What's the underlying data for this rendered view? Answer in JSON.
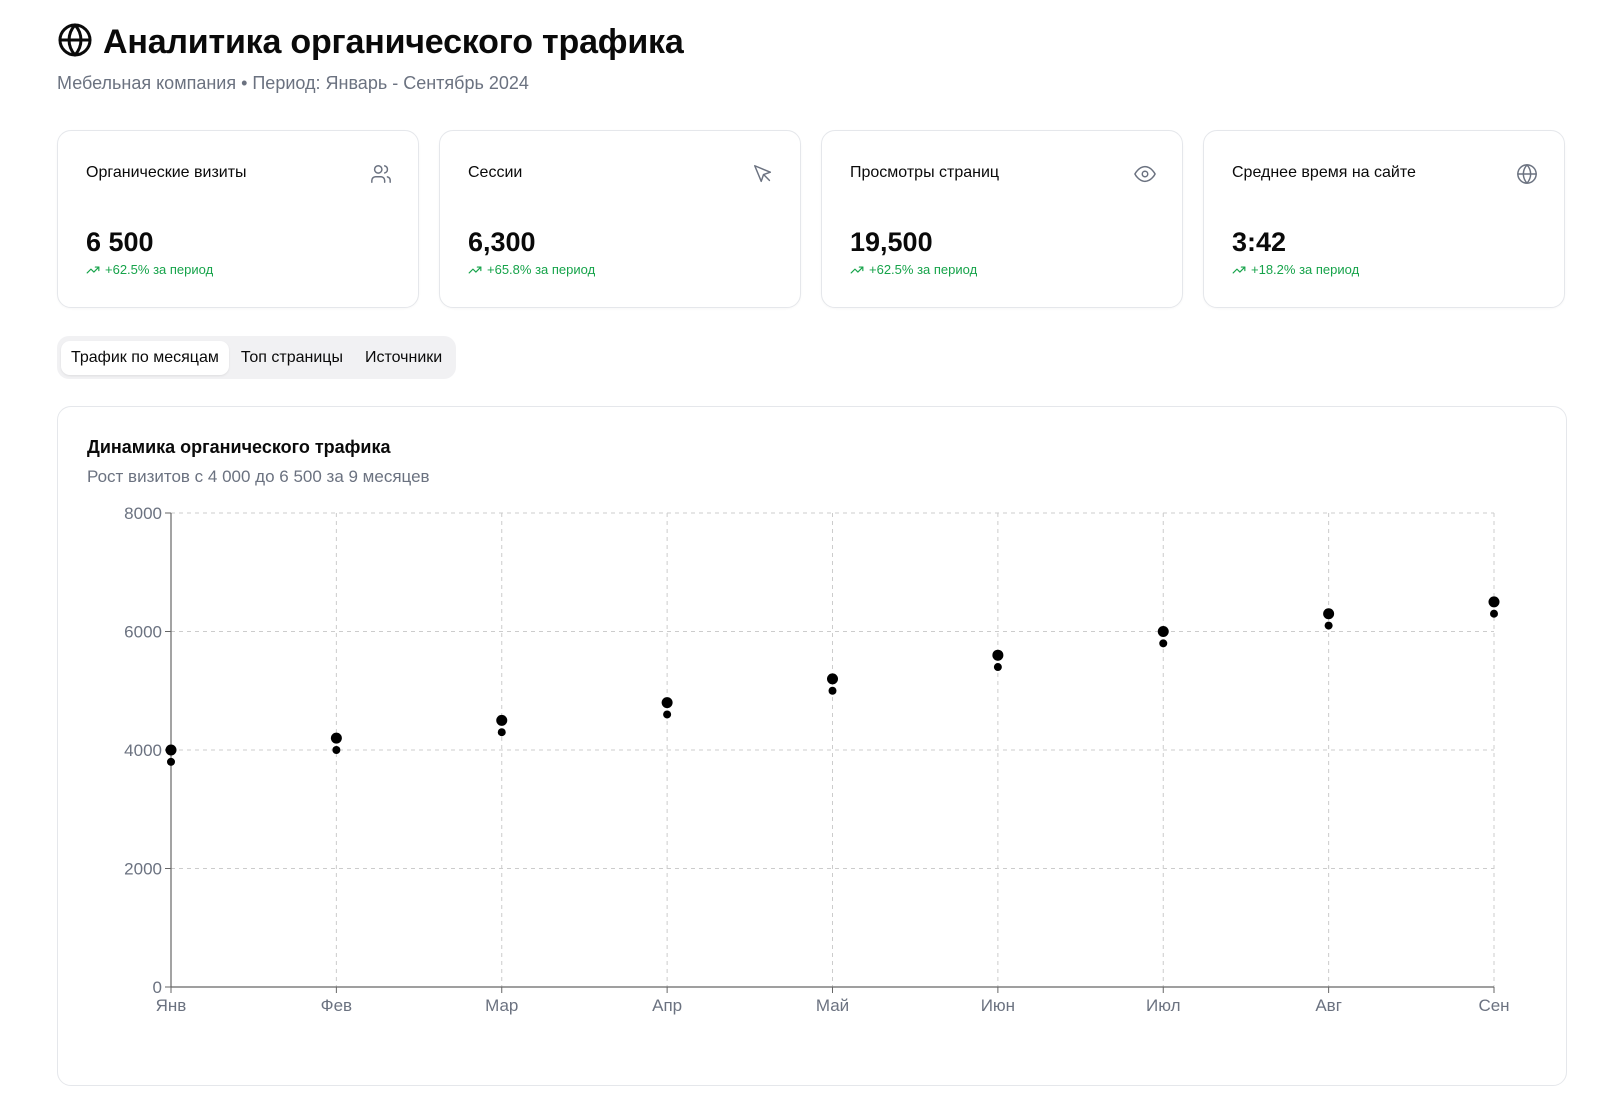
{
  "header": {
    "icon": "globe-icon",
    "title": "Аналитика органического трафика",
    "subtitle": "Мебельная компания • Период: Январь - Сентябрь 2024"
  },
  "cards": [
    {
      "label": "Органические визиты",
      "icon": "users-icon",
      "value": "6 500",
      "delta": "+62.5% за период"
    },
    {
      "label": "Сессии",
      "icon": "cursor-icon",
      "value": "6,300",
      "delta": "+65.8% за период"
    },
    {
      "label": "Просмотры страниц",
      "icon": "eye-icon",
      "value": "19,500",
      "delta": "+62.5% за период"
    },
    {
      "label": "Среднее время на сайте",
      "icon": "globe-icon",
      "value": "3:42",
      "delta": "+18.2% за период"
    }
  ],
  "colors": {
    "accent_positive": "#16a34a",
    "muted_text": "#6b7280",
    "border": "#e5e7eb",
    "point": "#000000"
  },
  "tabs": [
    {
      "label": "Трафик по месяцам",
      "active": true
    },
    {
      "label": "Топ страницы",
      "active": false
    },
    {
      "label": "Источники",
      "active": false
    }
  ],
  "chart": {
    "title": "Динамика органического трафика",
    "subtitle": "Рост визитов с 4 000 до 6 500 за 9 месяцев"
  },
  "chart_data": {
    "type": "scatter",
    "categories": [
      "Янв",
      "Фев",
      "Мар",
      "Апр",
      "Май",
      "Июн",
      "Июл",
      "Авг",
      "Сен"
    ],
    "series": [
      {
        "values": [
          4000,
          4200,
          4500,
          4800,
          5200,
          5600,
          6000,
          6300,
          6500
        ]
      },
      {
        "values": [
          3800,
          4000,
          4300,
          4600,
          5000,
          5400,
          5800,
          6100,
          6300
        ]
      }
    ],
    "yticks": [
      0,
      2000,
      4000,
      6000,
      8000
    ],
    "ylim": [
      0,
      8000
    ],
    "grid": true,
    "xlabel": "",
    "ylabel": ""
  }
}
